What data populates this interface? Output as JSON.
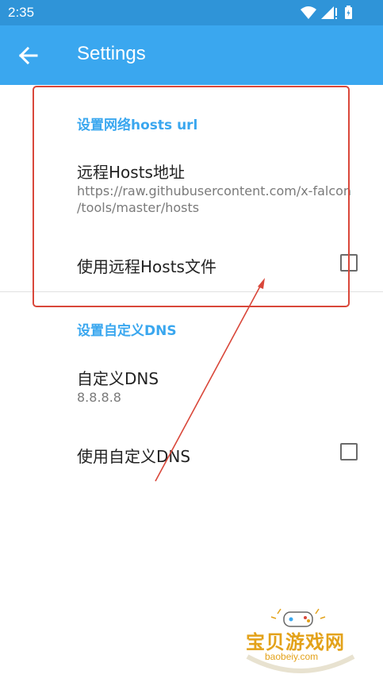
{
  "status_bar": {
    "time": "2:35"
  },
  "app_bar": {
    "title": "Settings",
    "back_icon": "arrow-back-icon"
  },
  "hosts_section": {
    "category": "设置网络hosts url",
    "remote_hosts": {
      "title": "远程Hosts地址",
      "summary": "https://raw.githubusercontent.com/x-falcon\n/tools/master/hosts"
    },
    "use_remote_hosts": {
      "title": "使用远程Hosts文件",
      "checked": false
    }
  },
  "dns_section": {
    "category": "设置自定义DNS",
    "custom_dns": {
      "title": "自定义DNS",
      "summary": "8.8.8.8"
    },
    "use_custom_dns": {
      "title": "使用自定义DNS",
      "checked": false
    }
  },
  "watermark": {
    "title": "宝贝游戏网",
    "url": "baobeiy.com"
  },
  "colors": {
    "status_bar": "#2f94d8",
    "app_bar": "#3aa7ef",
    "accent": "#3aa7ef",
    "annotation": "#d9473a"
  }
}
